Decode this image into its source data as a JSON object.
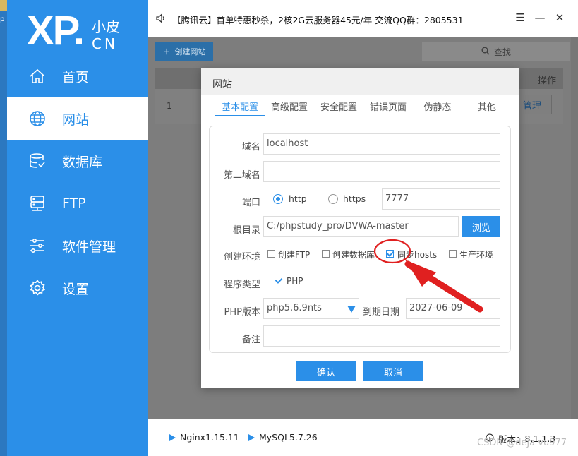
{
  "app": {
    "logo_main": "XP.",
    "logo_small": "小皮",
    "logo_cn": "CN",
    "accent": "#2b8fe8"
  },
  "sidebar": {
    "items": [
      {
        "label": "首页",
        "icon": "home-icon",
        "active": false
      },
      {
        "label": "网站",
        "icon": "globe-icon",
        "active": true
      },
      {
        "label": "数据库",
        "icon": "database-icon",
        "active": false
      },
      {
        "label": "FTP",
        "icon": "server-icon",
        "active": false
      },
      {
        "label": "软件管理",
        "icon": "sliders-icon",
        "active": false
      },
      {
        "label": "设置",
        "icon": "gear-icon",
        "active": false
      }
    ]
  },
  "titlebar": {
    "notice": "【腾讯云】首单特惠秒杀，2核2G云服务器45元/年 交流QQ群：2805531",
    "menu_icon": "☰",
    "minimize": "—",
    "close": "✕"
  },
  "toolbar": {
    "add_site": "创建网站",
    "search": "查找"
  },
  "table": {
    "header_action": "操作",
    "rows": [
      {
        "num": "1",
        "action": "管理"
      }
    ]
  },
  "modal": {
    "title": "网站",
    "tabs": [
      "基本配置",
      "高级配置",
      "安全配置",
      "错误页面",
      "伪静态",
      "其他"
    ],
    "active_tab": 0,
    "domain_label": "域名",
    "domain_value": "localhost",
    "second_domain_label": "第二域名",
    "second_domain_value": "",
    "port_label": "端口",
    "http_label": "http",
    "https_label": "https",
    "port_value": "7777",
    "root_label": "根目录",
    "root_value": "C:/phpstudy_pro/DVWA-master",
    "browse": "浏览",
    "env_label": "创建环境",
    "env_options": [
      {
        "label": "创建FTP",
        "checked": false
      },
      {
        "label": "创建数据库",
        "checked": false
      },
      {
        "label": "同步hosts",
        "checked": true
      },
      {
        "label": "生产环境",
        "checked": false
      }
    ],
    "program_label": "程序类型",
    "program_option": "PHP",
    "php_version_label": "PHP版本",
    "php_version_value": "php5.6.9nts",
    "expire_label": "到期日期",
    "expire_value": "2027-06-09",
    "remark_label": "备注",
    "remark_value": "",
    "confirm": "确认",
    "cancel": "取消"
  },
  "statusbar": {
    "nginx": "Nginx1.15.11",
    "mysql": "MySQL5.7.26",
    "version_label": "版本：",
    "version": "8.1.1.3",
    "watermark": "CSDN @deja vu977"
  }
}
